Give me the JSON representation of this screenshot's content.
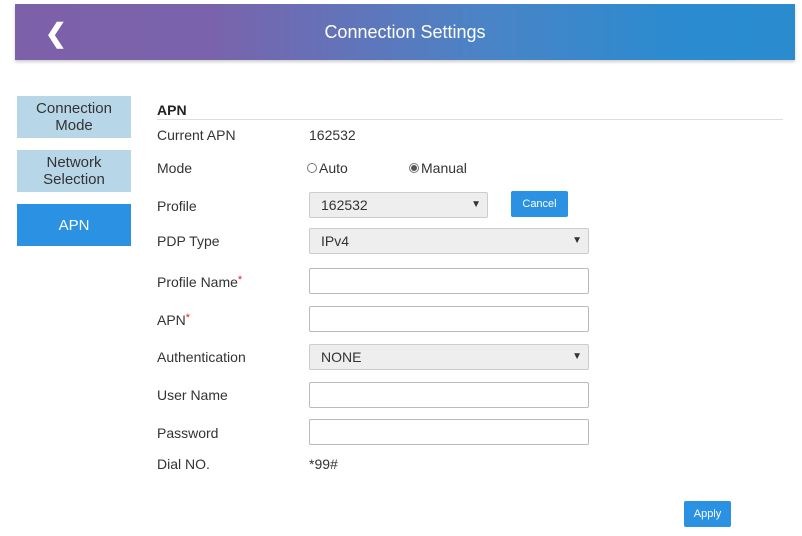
{
  "header": {
    "title": "Connection Settings",
    "back_icon": "chevron-left-icon"
  },
  "sidebar": [
    {
      "label": "Connection Mode"
    },
    {
      "label": "Network Selection"
    },
    {
      "label": "APN"
    }
  ],
  "section_title": "APN",
  "fields": {
    "current_apn": {
      "label": "Current APN",
      "value": "162532"
    },
    "mode": {
      "label": "Mode",
      "options": [
        "Auto",
        "Manual"
      ],
      "selected": "Manual"
    },
    "profile": {
      "label": "Profile",
      "value": "162532"
    },
    "pdp_type": {
      "label": "PDP Type",
      "value": "IPv4"
    },
    "profile_name": {
      "label": "Profile Name",
      "value": ""
    },
    "apn": {
      "label": "APN",
      "value": ""
    },
    "authentication": {
      "label": "Authentication",
      "value": "NONE"
    },
    "user_name": {
      "label": "User Name",
      "value": ""
    },
    "password": {
      "label": "Password",
      "value": ""
    },
    "dial_no": {
      "label": "Dial NO.",
      "value": "*99#"
    }
  },
  "required_mark": "*",
  "buttons": {
    "cancel": "Cancel",
    "apply": "Apply"
  },
  "colors": {
    "accent": "#2a91e3",
    "sidebar": "#b7d7e8"
  }
}
